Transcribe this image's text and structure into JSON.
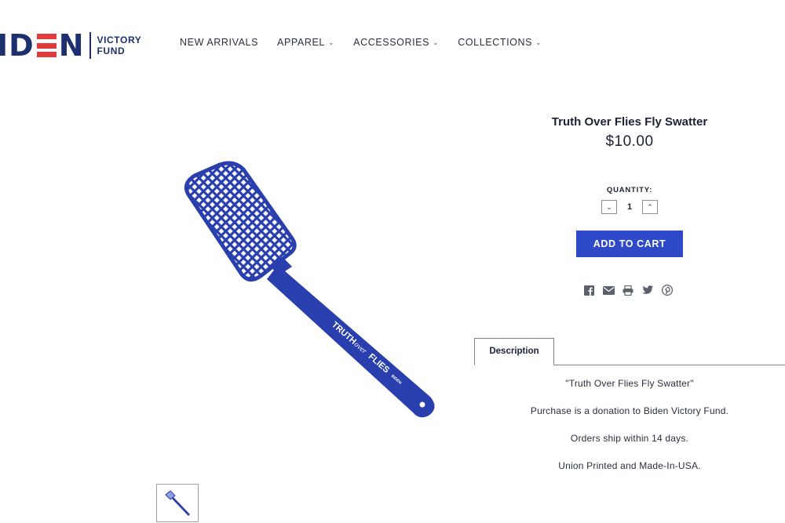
{
  "logo": {
    "left": "ID",
    "right": "N",
    "line1": "VICTORY",
    "line2": "FUND"
  },
  "nav": [
    {
      "label": "NEW ARRIVALS",
      "has_dropdown": false
    },
    {
      "label": "APPAREL",
      "has_dropdown": true
    },
    {
      "label": "ACCESSORIES",
      "has_dropdown": true
    },
    {
      "label": "COLLECTIONS",
      "has_dropdown": true
    }
  ],
  "chevron_glyph": "⌄",
  "product": {
    "title": "Truth Over Flies Fly Swatter",
    "price": "$10.00",
    "quantity_label": "QUANTITY:",
    "quantity": "1",
    "qty_down": "⌄",
    "qty_up": "⌃",
    "add_to_cart": "ADD TO CART",
    "image_text_truth": "TRUTH",
    "image_text_over": "over",
    "image_text_flies": "FLIES",
    "image_text_brand": "BIDEN"
  },
  "share_icons": [
    "facebook-icon",
    "email-icon",
    "print-icon",
    "twitter-icon",
    "pinterest-icon"
  ],
  "tabs": {
    "description": "Description"
  },
  "description": {
    "line1": "\"Truth Over Flies Fly Swatter\"",
    "line2": "Purchase is a donation to Biden Victory Fund.",
    "line3": "Orders ship within 14 days.",
    "line4": "Union Printed and Made-In-USA."
  },
  "colors": {
    "brand_navy": "#1d2f6f",
    "brand_red": "#e23b3b",
    "button_blue": "#2f4ac8",
    "swatter_blue": "#2a3fae",
    "icon_gray": "#5c606b"
  }
}
